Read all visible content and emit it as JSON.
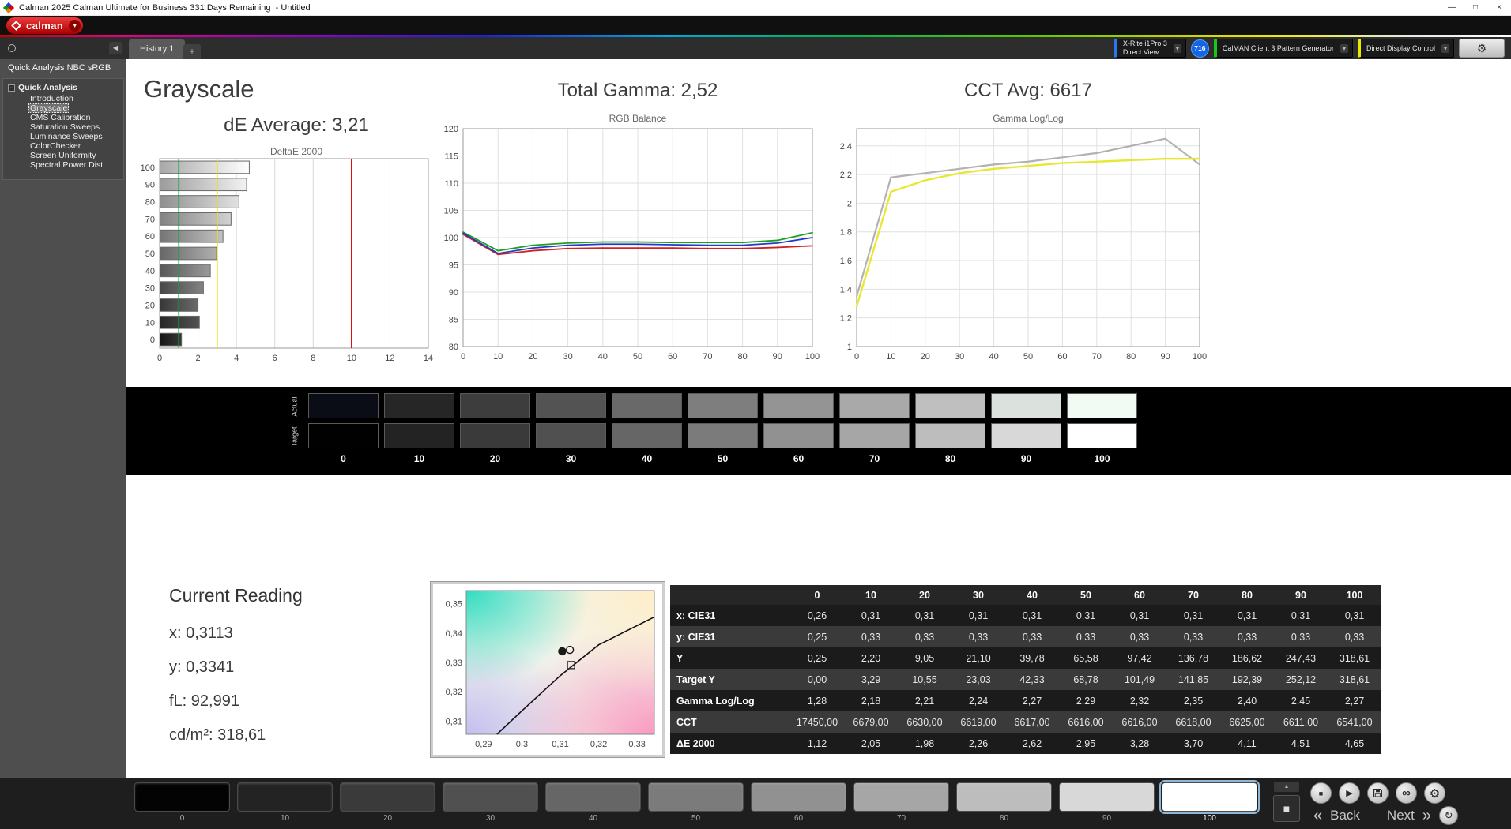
{
  "titlebar": {
    "title": "Calman 2025 Calman Ultimate for Business 331 Days Remaining  - Untitled"
  },
  "icons": {
    "minimize": "—",
    "maximize": "□",
    "close": "×",
    "dropdown": "▾",
    "collapse_left": "◀",
    "tree_expander": "-",
    "chevron_up": "▲",
    "stop": "■",
    "play": "▶",
    "link": "∞",
    "gear": "⚙",
    "refresh": "↻",
    "back_chevrons": "«",
    "next_chevrons": "»",
    "window_patch": "■"
  },
  "logo": {
    "brand": "calman"
  },
  "tabs": {
    "history": "History 1",
    "add": "+"
  },
  "meter_bar": {
    "meter_line1": "X-Rite i1Pro 3",
    "meter_line2": "Direct View",
    "badge": "716",
    "pattern_generator": "CalMAN Client 3 Pattern Generator",
    "display_control": "Direct Display Control"
  },
  "sidebar": {
    "header": "Quick Analysis NBC sRGB",
    "root": "Quick Analysis",
    "items": [
      "Introduction",
      "Grayscale",
      "CMS Calibration",
      "Saturation Sweeps",
      "Luminance Sweeps",
      "ColorChecker",
      "Screen Uniformity",
      "Spectral Power Dist."
    ],
    "selected_index": 1
  },
  "headings": {
    "page_title": "Grayscale",
    "de_average": "dE Average: 3,21",
    "total_gamma": "Total Gamma: 2,52",
    "cct_avg": "CCT Avg: 6617"
  },
  "chart_data": [
    {
      "type": "bar",
      "title": "DeltaE 2000",
      "orientation": "horizontal",
      "categories": [
        "100",
        "90",
        "80",
        "70",
        "60",
        "50",
        "40",
        "30",
        "20",
        "10",
        "0"
      ],
      "values": [
        4.65,
        4.51,
        4.11,
        3.7,
        3.28,
        2.95,
        2.62,
        2.26,
        1.98,
        2.05,
        1.12
      ],
      "xlim": [
        0,
        14
      ],
      "xticks": [
        0,
        2,
        4,
        6,
        8,
        10,
        12,
        14
      ],
      "bar_fills": [
        {
          "from": "#a8a8a8",
          "to": "#ffffff"
        },
        {
          "from": "#9c9c9c",
          "to": "#f2f2f2"
        },
        {
          "from": "#8f8f8f",
          "to": "#e2e2e2"
        },
        {
          "from": "#828282",
          "to": "#d2d2d2"
        },
        {
          "from": "#757575",
          "to": "#c2c2c2"
        },
        {
          "from": "#676767",
          "to": "#b0b0b0"
        },
        {
          "from": "#585858",
          "to": "#9a9a9a"
        },
        {
          "from": "#484848",
          "to": "#828282"
        },
        {
          "from": "#383838",
          "to": "#6a6a6a"
        },
        {
          "from": "#282828",
          "to": "#525252"
        },
        {
          "from": "#161616",
          "to": "#383838"
        }
      ],
      "reference_lines": [
        {
          "x": 1,
          "color": "#00a83c",
          "label": "green-limit"
        },
        {
          "x": 3,
          "color": "#e6e600",
          "label": "yellow-limit"
        },
        {
          "x": 10,
          "color": "#dc0000",
          "label": "red-limit"
        }
      ]
    },
    {
      "type": "line",
      "title": "RGB Balance",
      "x": [
        0,
        10,
        20,
        30,
        40,
        50,
        60,
        70,
        80,
        90,
        100
      ],
      "xticks": [
        0,
        10,
        20,
        30,
        40,
        50,
        60,
        70,
        80,
        90,
        100
      ],
      "ylim": [
        80,
        120
      ],
      "ytick_values": [
        80,
        85,
        90,
        95,
        100,
        105,
        110,
        115,
        120
      ],
      "ytick_labels": [
        "80",
        "85",
        "90",
        "95",
        "100",
        "105",
        "110",
        "115",
        "120"
      ],
      "series": [
        {
          "name": "Red",
          "color": "#d42020",
          "values": [
            100.6,
            96.9,
            97.6,
            98.0,
            98.1,
            98.1,
            98.1,
            98.0,
            98.0,
            98.2,
            98.5
          ]
        },
        {
          "name": "Green",
          "color": "#1ea01e",
          "values": [
            101.0,
            97.6,
            98.6,
            99.0,
            99.2,
            99.2,
            99.1,
            99.1,
            99.1,
            99.5,
            100.9
          ]
        },
        {
          "name": "Blue",
          "color": "#2238cc",
          "values": [
            100.8,
            97.1,
            98.1,
            98.6,
            98.8,
            98.8,
            98.7,
            98.6,
            98.6,
            99.0,
            100.0
          ]
        }
      ]
    },
    {
      "type": "line",
      "title": "Gamma Log/Log",
      "x": [
        0,
        10,
        20,
        30,
        40,
        50,
        60,
        70,
        80,
        90,
        100
      ],
      "xticks": [
        0,
        10,
        20,
        30,
        40,
        50,
        60,
        70,
        80,
        90,
        100
      ],
      "ylim": [
        1.0,
        2.52
      ],
      "ytick_values": [
        1.0,
        1.2,
        1.4,
        1.6,
        1.8,
        2.0,
        2.2,
        2.4
      ],
      "ytick_labels": [
        "1",
        "1,2",
        "1,4",
        "1,6",
        "1,8",
        "2",
        "2,2",
        "2,4"
      ],
      "series": [
        {
          "name": "Measured",
          "color": "#b2b2b2",
          "width": 2.2,
          "values": [
            1.35,
            2.18,
            2.21,
            2.24,
            2.27,
            2.29,
            2.32,
            2.35,
            2.4,
            2.45,
            2.27
          ]
        },
        {
          "name": "Target",
          "color": "#e8e832",
          "width": 2.4,
          "values": [
            1.28,
            2.08,
            2.16,
            2.21,
            2.24,
            2.26,
            2.28,
            2.29,
            2.3,
            2.31,
            2.31
          ]
        }
      ]
    }
  ],
  "swatches": {
    "row_labels": [
      "Actual",
      "Target"
    ],
    "levels": [
      "0",
      "10",
      "20",
      "30",
      "40",
      "50",
      "60",
      "70",
      "80",
      "90",
      "100"
    ],
    "actual": [
      "#0a0c16",
      "#262626",
      "#3d3d3d",
      "#535353",
      "#696969",
      "#7e7e7e",
      "#949494",
      "#a9a9a9",
      "#bfbfbf",
      "#dbe2de",
      "#f1fbf4"
    ],
    "target": [
      "#010101",
      "#232323",
      "#3a3a3a",
      "#505050",
      "#666666",
      "#7b7b7b",
      "#919191",
      "#a6a6a6",
      "#bdbdbd",
      "#d8d8d8",
      "#ffffff"
    ]
  },
  "current_reading": {
    "title": "Current Reading",
    "lines": [
      "x: 0,3113",
      "y: 0,3341",
      "fL: 92,991",
      "cd/m²: 318,61"
    ]
  },
  "cie": {
    "xlim": [
      0.2855,
      0.3345
    ],
    "ylim": [
      0.3055,
      0.3545
    ],
    "xtick_values": [
      0.29,
      0.3,
      0.31,
      0.32,
      0.33
    ],
    "xtick_labels": [
      "0,29",
      "0,3",
      "0,31",
      "0,32",
      "0,33"
    ],
    "ytick_values": [
      0.31,
      0.32,
      0.33,
      0.34,
      0.35
    ],
    "ytick_labels": [
      "0,31",
      "0,32",
      "0,33",
      "0,34",
      "0,35"
    ],
    "locus": [
      [
        0.2935,
        0.3055
      ],
      [
        0.3,
        0.3135
      ],
      [
        0.31,
        0.3255
      ],
      [
        0.32,
        0.336
      ],
      [
        0.3345,
        0.3455
      ]
    ],
    "markers": [
      {
        "type": "circle",
        "x": 0.3105,
        "y": 0.3338,
        "filled": true
      },
      {
        "type": "circle",
        "x": 0.3125,
        "y": 0.3343,
        "filled": false
      },
      {
        "type": "square",
        "x": 0.3128,
        "y": 0.3291,
        "filled": false
      }
    ]
  },
  "table": {
    "columns": [
      "0",
      "10",
      "20",
      "30",
      "40",
      "50",
      "60",
      "70",
      "80",
      "90",
      "100"
    ],
    "rows": [
      {
        "label": "x: CIE31",
        "values": [
          "0,26",
          "0,31",
          "0,31",
          "0,31",
          "0,31",
          "0,31",
          "0,31",
          "0,31",
          "0,31",
          "0,31",
          "0,31"
        ]
      },
      {
        "label": "y: CIE31",
        "values": [
          "0,25",
          "0,33",
          "0,33",
          "0,33",
          "0,33",
          "0,33",
          "0,33",
          "0,33",
          "0,33",
          "0,33",
          "0,33"
        ]
      },
      {
        "label": "Y",
        "values": [
          "0,25",
          "2,20",
          "9,05",
          "21,10",
          "39,78",
          "65,58",
          "97,42",
          "136,78",
          "186,62",
          "247,43",
          "318,61"
        ]
      },
      {
        "label": "Target Y",
        "values": [
          "0,00",
          "3,29",
          "10,55",
          "23,03",
          "42,33",
          "68,78",
          "101,49",
          "141,85",
          "192,39",
          "252,12",
          "318,61"
        ]
      },
      {
        "label": "Gamma Log/Log",
        "values": [
          "1,28",
          "2,18",
          "2,21",
          "2,24",
          "2,27",
          "2,29",
          "2,32",
          "2,35",
          "2,40",
          "2,45",
          "2,27"
        ]
      },
      {
        "label": "CCT",
        "values": [
          "17450,00",
          "6679,00",
          "6630,00",
          "6619,00",
          "6617,00",
          "6616,00",
          "6616,00",
          "6618,00",
          "6625,00",
          "6611,00",
          "6541,00"
        ]
      },
      {
        "label": "ΔE 2000",
        "values": [
          "1,12",
          "2,05",
          "1,98",
          "2,26",
          "2,62",
          "2,95",
          "3,28",
          "3,70",
          "4,11",
          "4,51",
          "4,65"
        ]
      }
    ]
  },
  "bottom_bar": {
    "labels": [
      "0",
      "10",
      "20",
      "30",
      "40",
      "50",
      "60",
      "70",
      "80",
      "90",
      "100"
    ],
    "colors": [
      "#030303",
      "#232323",
      "#3a3a3a",
      "#505050",
      "#666666",
      "#7b7b7b",
      "#919191",
      "#a6a6a6",
      "#bdbdbd",
      "#d8d8d8",
      "#ffffff"
    ],
    "selected_index": 10,
    "back": "Back",
    "next": "Next"
  }
}
